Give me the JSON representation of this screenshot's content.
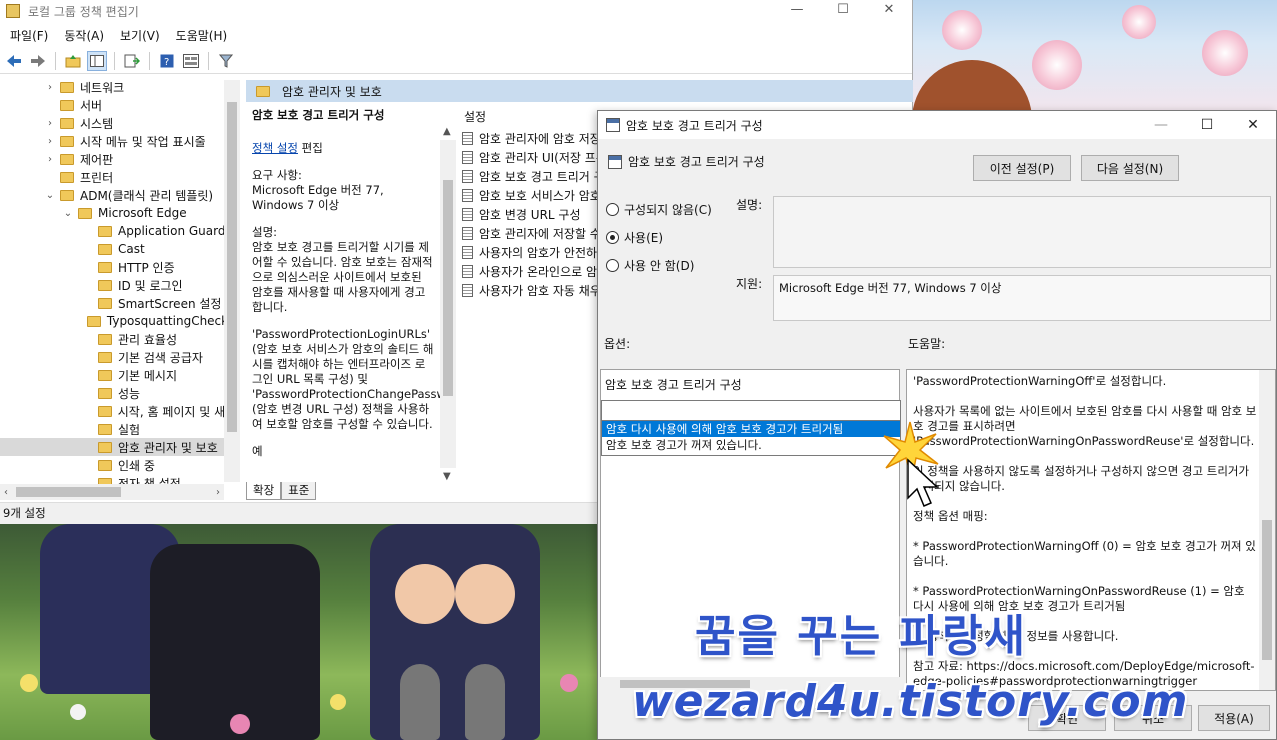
{
  "main_window": {
    "title": "로컬 그룹 정책 편집기",
    "controls": {
      "minimize": "—",
      "maximize": "☐",
      "close": "✕"
    },
    "menu": [
      "파일(F)",
      "동작(A)",
      "보기(V)",
      "도움말(H)"
    ]
  },
  "tree": {
    "items": [
      {
        "label": "네트워크",
        "exp": "›"
      },
      {
        "label": "서버",
        "exp": ""
      },
      {
        "label": "시스템",
        "exp": "›"
      },
      {
        "label": "시작 메뉴 및 작업 표시줄",
        "exp": "›"
      },
      {
        "label": "제어판",
        "exp": "›"
      },
      {
        "label": "프린터",
        "exp": ""
      },
      {
        "label": "ADM(클래식 관리 템플릿)",
        "exp": "⌄"
      },
      {
        "label": "Microsoft Edge",
        "exp": "⌄"
      },
      {
        "label": "Application Guard",
        "exp": ""
      },
      {
        "label": "Cast",
        "exp": ""
      },
      {
        "label": "HTTP 인증",
        "exp": ""
      },
      {
        "label": "ID 및 로그인",
        "exp": ""
      },
      {
        "label": "SmartScreen 설정",
        "exp": ""
      },
      {
        "label": "TyposquattingChecker",
        "exp": ""
      },
      {
        "label": "관리 효율성",
        "exp": ""
      },
      {
        "label": "기본 검색 공급자",
        "exp": ""
      },
      {
        "label": "기본 메시지",
        "exp": ""
      },
      {
        "label": "성능",
        "exp": ""
      },
      {
        "label": "시작, 홈 페이지 및 새 탭",
        "exp": ""
      },
      {
        "label": "실험",
        "exp": ""
      },
      {
        "label": "암호 관리자 및 보호",
        "exp": ""
      },
      {
        "label": "인쇄 중",
        "exp": ""
      },
      {
        "label": "전자 책 설정",
        "exp": ""
      }
    ],
    "scroll_left": "‹",
    "scroll_right": "›"
  },
  "right_pane": {
    "header": "암호 관리자 및 보호",
    "desc_title": "암호 보호 경고 트리거 구성",
    "policy_link": "정책 설정",
    "edit_text": "편집",
    "req_label": "요구 사항:",
    "req_value": "Microsoft Edge 버전 77, Windows 7 이상",
    "desc_label": "설명:",
    "desc_p1": "암호 보호 경고를 트리거할 시기를 제어할 수 있습니다. 암호 보호는 잠재적으로 의심스러운 사이트에서 보호된 암호를 재사용할 때 사용자에게 경고합니다.",
    "desc_p2": "'PasswordProtectionLoginURLs' (암호 보호 서비스가 암호의 솔티드 해시를 캡처해야 하는 엔터프라이즈 로그인 URL 목록 구성) 및 'PasswordProtectionChangePasswordURL' (암호 변경 URL 구성) 정책을 사용하여 보호할 암호를 구성할 수 있습니다.",
    "desc_p3": "예",
    "settings_header": "설정",
    "settings": [
      "암호 관리자에 암호 저장 사용",
      "암호 관리자 UI(저장 프롬프트)",
      "암호 보호 경고 트리거 구성",
      "암호 보호 서비스가 암호를",
      "암호 변경 URL 구성",
      "암호 관리자에 저장할 수",
      "사용자의 암호가 안전하지",
      "사용자가 온라인으로 암호",
      "사용자가 암호 자동 채우기"
    ],
    "tabs": [
      "확장",
      "표준"
    ]
  },
  "status_bar": {
    "text": "9개 설정"
  },
  "dialog": {
    "title": "암호 보호 경고 트리거 구성",
    "controls": {
      "minimize": "—",
      "maximize": "☐",
      "close": "✕"
    },
    "heading": "암호 보호 경고 트리거 구성",
    "prev_button": "이전 설정(P)",
    "next_button": "다음 설정(N)",
    "radio_options": [
      "구성되지 않음(C)",
      "사용(E)",
      "사용 안 함(D)"
    ],
    "selected_radio": "사용(E)",
    "comment_label": "설명:",
    "supported_label": "지원:",
    "supported_value": "Microsoft Edge 버전 77, Windows 7 이상",
    "options_label": "옵션:",
    "help_label": "도움말:",
    "option_title": "암호 보호 경고 트리거 구성",
    "dropdown_options": [
      "암호 다시 사용에 의해 암호 보호 경고가 트리거됨",
      "암호 보호 경고가 꺼져 있습니다."
    ],
    "help_paragraphs": [
      "'PasswordProtectionWarningOff'로 설정합니다.",
      "사용자가 목록에 없는 사이트에서 보호된 암호를 다시 사용할 때 암호 보호 경고를 표시하려면 'PasswordProtectionWarningOnPasswordReuse'로 설정합니다.",
      "이 정책을 사용하지 않도록 설정하거나 구성하지 않으면 경고 트리거가 표시되지 않습니다.",
      "정책 옵션 매핑:",
      "* PasswordProtectionWarningOff (0) = 암호 보호 경고가 꺼져 있습니다.",
      "* PasswordProtectionWarningOnPasswordReuse (1) = 암호 다시 사용에 의해 암호 보호 경고가 트리거됨",
      "이 정책을 구성할 때 이 정보를 사용합니다.",
      "참고 자료: https://docs.microsoft.com/DeployEdge/microsoft-edge-policies#passwordprotectionwarningtrigger"
    ],
    "ok_button": "확인",
    "cancel_button": "취소",
    "apply_button": "적용(A)"
  },
  "watermark": {
    "line1": "꿈을 꾸는 파랑새",
    "line2": "wezard4u.tistory.com"
  },
  "colors": {
    "selection": "#0078d7",
    "header_band": "#c9dcef",
    "link": "#0645ad",
    "watermark": "#2f54c9"
  },
  "icons": [
    "back-arrow-icon",
    "forward-arrow-icon",
    "folder-up-icon",
    "show-hide-tree-icon",
    "export-list-icon",
    "help-icon",
    "properties-icon",
    "filter-icon",
    "folder-icon",
    "policy-setting-icon",
    "group-policy-icon",
    "mouse-cursor-icon",
    "click-spark-icon"
  ]
}
